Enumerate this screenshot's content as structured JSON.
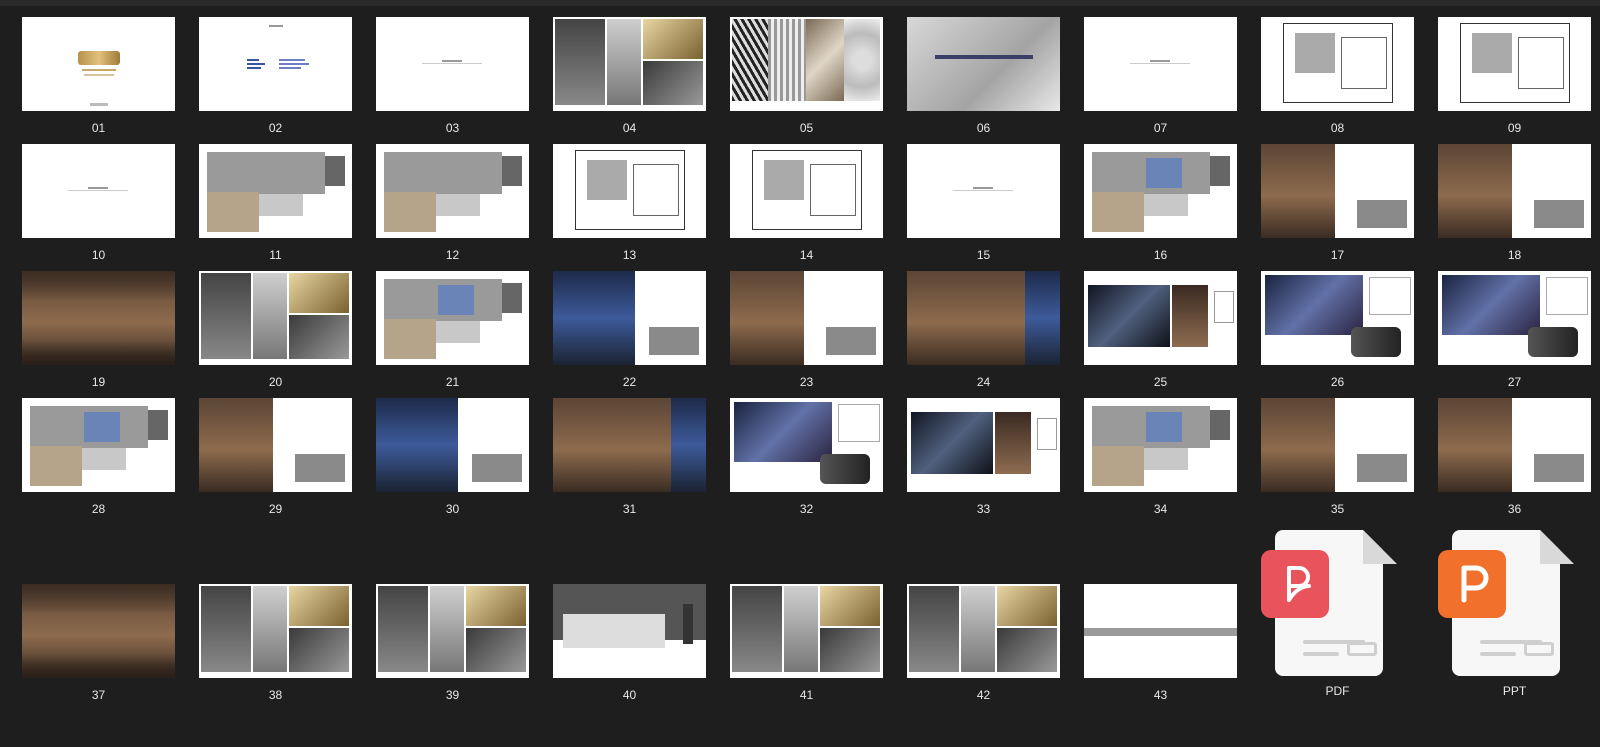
{
  "tiles": [
    {
      "label": "01",
      "style": "cover"
    },
    {
      "label": "02",
      "style": "text"
    },
    {
      "label": "03",
      "style": "title"
    },
    {
      "label": "04",
      "style": "mood"
    },
    {
      "label": "05",
      "style": "texture"
    },
    {
      "label": "06",
      "style": "grey"
    },
    {
      "label": "07",
      "style": "title"
    },
    {
      "label": "08",
      "style": "plan-line"
    },
    {
      "label": "09",
      "style": "plan-line"
    },
    {
      "label": "10",
      "style": "title"
    },
    {
      "label": "11",
      "style": "plan"
    },
    {
      "label": "12",
      "style": "plan"
    },
    {
      "label": "13",
      "style": "plan-line"
    },
    {
      "label": "14",
      "style": "plan-line"
    },
    {
      "label": "15",
      "style": "title"
    },
    {
      "label": "16",
      "style": "plan-blue"
    },
    {
      "label": "17",
      "style": "render-half"
    },
    {
      "label": "18",
      "style": "render-half"
    },
    {
      "label": "19",
      "style": "render"
    },
    {
      "label": "20",
      "style": "mood"
    },
    {
      "label": "21",
      "style": "plan-blue"
    },
    {
      "label": "22",
      "style": "render-blue-half"
    },
    {
      "label": "23",
      "style": "render-half"
    },
    {
      "label": "24",
      "style": "render-blue-full"
    },
    {
      "label": "25",
      "style": "mood-dark"
    },
    {
      "label": "26",
      "style": "mood-blue"
    },
    {
      "label": "27",
      "style": "mood-blue"
    },
    {
      "label": "28",
      "style": "plan-blue"
    },
    {
      "label": "29",
      "style": "render-half"
    },
    {
      "label": "30",
      "style": "render-blue-half"
    },
    {
      "label": "31",
      "style": "render-blue-full"
    },
    {
      "label": "32",
      "style": "mood-blue"
    },
    {
      "label": "33",
      "style": "mood-dark"
    },
    {
      "label": "34",
      "style": "plan-blue"
    },
    {
      "label": "35",
      "style": "render-half"
    },
    {
      "label": "36",
      "style": "render-half"
    },
    {
      "label": "37",
      "style": "render"
    },
    {
      "label": "38",
      "style": "mood"
    },
    {
      "label": "39",
      "style": "mood"
    },
    {
      "label": "40",
      "style": "elevation"
    },
    {
      "label": "41",
      "style": "mood"
    },
    {
      "label": "42",
      "style": "mood"
    },
    {
      "label": "43",
      "style": "band"
    }
  ],
  "files": [
    {
      "label": "PDF",
      "color": "#e9535b",
      "icon": "pdf-icon"
    },
    {
      "label": "PPT",
      "color": "#f0702c",
      "icon": "ppt-icon"
    }
  ]
}
